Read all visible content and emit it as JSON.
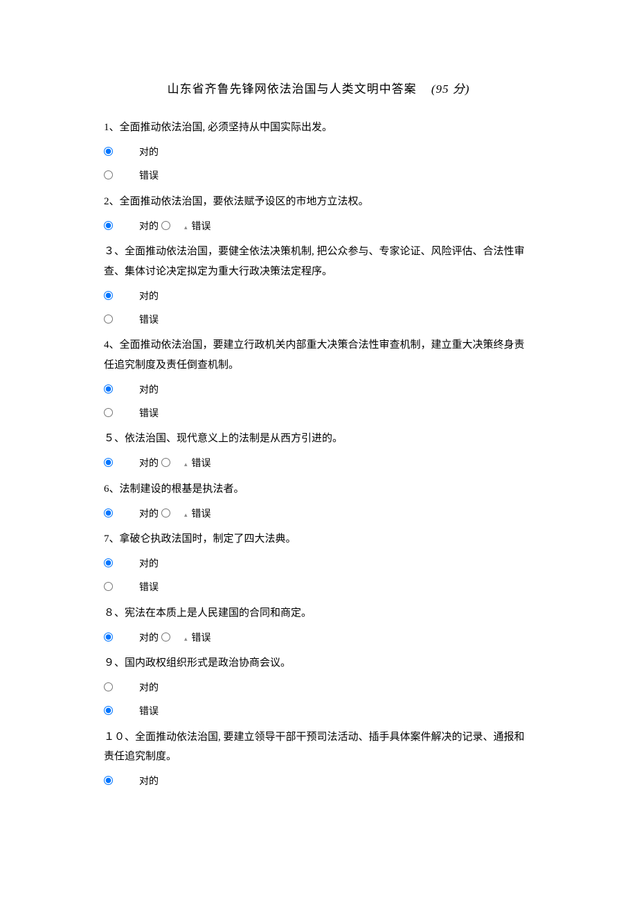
{
  "title_prefix": "山东省齐鲁先锋网依法治国与人类文明中答案",
  "title_score": "(95 分)",
  "labels": {
    "correct": "对的",
    "wrong": "错误"
  },
  "arrow": "▴",
  "questions": [
    {
      "num": "1、",
      "text": "全面推动依法治国, 必须坚持从中国实际出发。",
      "layout": "stacked",
      "selected": "a"
    },
    {
      "num": "2、",
      "text": "全面推动依法治国，要依法赋予设区的市地方立法权。",
      "layout": "inline",
      "selected": "a"
    },
    {
      "num": "３、",
      "text": "全面推动依法治国，要健全依法决策机制, 把公众参与、专家论证、风险评估、合法性审查、集体讨论决定拟定为重大行政决策法定程序。",
      "layout": "stacked",
      "selected": "a"
    },
    {
      "num": "4、",
      "text": "全面推动依法治国，要建立行政机关内部重大决策合法性审查机制，建立重大决策终身责任追究制度及责任倒查机制。",
      "layout": "stacked",
      "selected": "a"
    },
    {
      "num": "５、",
      "text": "依法治国、现代意义上的法制是从西方引进的。",
      "layout": "inline",
      "selected": "a"
    },
    {
      "num": "6、",
      "text": "法制建设的根基是执法者。",
      "layout": "inline",
      "selected": "a"
    },
    {
      "num": "7、",
      "text": "拿破仑执政法国时，制定了四大法典。",
      "layout": "stacked",
      "selected": "a"
    },
    {
      "num": "８、",
      "text": "宪法在本质上是人民建国的合同和商定。",
      "layout": "inline",
      "selected": "a"
    },
    {
      "num": "９、",
      "text": "国内政权组织形式是政治协商会议。",
      "layout": "stacked",
      "selected": "b"
    },
    {
      "num": "１０、",
      "text": "全面推动依法治国, 要建立领导干部干预司法活动、插手具体案件解决的记录、通报和责任追究制度。",
      "layout": "single",
      "selected": "a"
    }
  ]
}
